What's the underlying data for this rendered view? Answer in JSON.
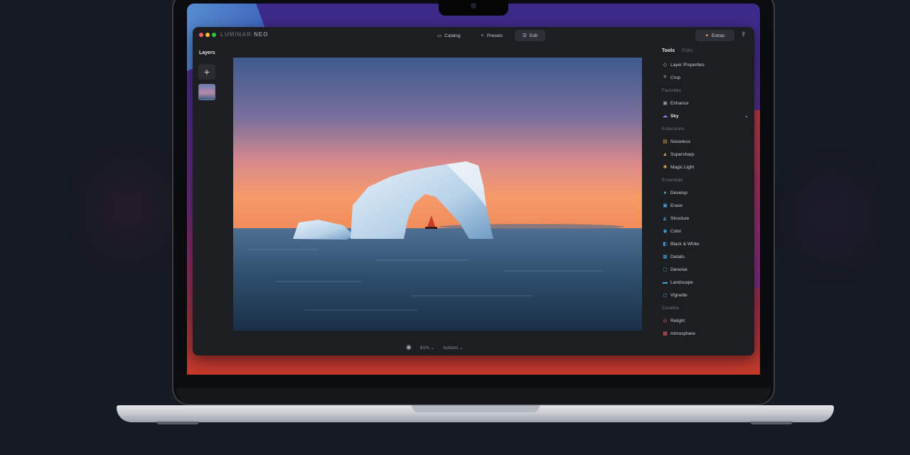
{
  "window": {
    "logo_main": "LUMINAR",
    "logo_accent": "NEO"
  },
  "tabs": [
    {
      "label": "Catalog",
      "icon": "folder-icon",
      "active": false
    },
    {
      "label": "Presets",
      "icon": "sparkle-icon",
      "active": false
    },
    {
      "label": "Edit",
      "icon": "sliders-icon",
      "active": true
    }
  ],
  "header": {
    "extras_label": "Extras",
    "share_icon": "share-icon"
  },
  "layers": {
    "title": "Layers",
    "add_label": "+"
  },
  "canvas": {
    "zoom": "61%",
    "zoom_chevron": "⌄",
    "actions_label": "Actions",
    "actions_chevron": "⌄"
  },
  "sidebar": {
    "tab_tools": "Tools",
    "tab_edits": "Edits",
    "items": [
      {
        "kind": "item",
        "label": "Layer Properties",
        "icon": "layers-icon",
        "glyph": "◇",
        "color": "#c9ccd2"
      },
      {
        "kind": "item",
        "label": "Crop",
        "icon": "crop-icon",
        "glyph": "⌗",
        "color": "#c9ccd2"
      },
      {
        "kind": "section",
        "label": "Favorites"
      },
      {
        "kind": "item",
        "label": "Enhance",
        "icon": "enhance-icon",
        "glyph": "▣",
        "color": "#9aa0aa"
      },
      {
        "kind": "item",
        "label": "Sky",
        "icon": "sky-icon",
        "glyph": "☁",
        "color": "#8f7ee0",
        "bold": true,
        "expanded": true
      },
      {
        "kind": "section",
        "label": "Extensions"
      },
      {
        "kind": "item",
        "label": "Noiseless",
        "icon": "noiseless-icon",
        "glyph": "▤",
        "color": "#e0a25a"
      },
      {
        "kind": "item",
        "label": "Supersharp",
        "icon": "supersharp-icon",
        "glyph": "▲",
        "color": "#e0a25a"
      },
      {
        "kind": "item",
        "label": "Magic Light",
        "icon": "magic-light-icon",
        "glyph": "✺",
        "color": "#e0a25a"
      },
      {
        "kind": "section",
        "label": "Essentials"
      },
      {
        "kind": "item",
        "label": "Develop",
        "icon": "develop-icon",
        "glyph": "●",
        "color": "#4aa3d8"
      },
      {
        "kind": "item",
        "label": "Erase",
        "icon": "erase-icon",
        "glyph": "▣",
        "color": "#4aa3d8"
      },
      {
        "kind": "item",
        "label": "Structure",
        "icon": "structure-icon",
        "glyph": "◭",
        "color": "#4aa3d8"
      },
      {
        "kind": "item",
        "label": "Color",
        "icon": "color-icon",
        "glyph": "◉",
        "color": "#4aa3d8"
      },
      {
        "kind": "item",
        "label": "Black & White",
        "icon": "black-white-icon",
        "glyph": "◧",
        "color": "#4aa3d8"
      },
      {
        "kind": "item",
        "label": "Details",
        "icon": "details-icon",
        "glyph": "▦",
        "color": "#4aa3d8"
      },
      {
        "kind": "item",
        "label": "Denoise",
        "icon": "denoise-icon",
        "glyph": "▢",
        "color": "#4aa3d8"
      },
      {
        "kind": "item",
        "label": "Landscape",
        "icon": "landscape-icon",
        "glyph": "▬",
        "color": "#4aa3d8"
      },
      {
        "kind": "item",
        "label": "Vignette",
        "icon": "vignette-icon",
        "glyph": "◻",
        "color": "#4aa3d8"
      },
      {
        "kind": "section",
        "label": "Creative"
      },
      {
        "kind": "item",
        "label": "Relight",
        "icon": "relight-icon",
        "glyph": "◎",
        "color": "#e05a6a"
      },
      {
        "kind": "item",
        "label": "Atmosphere",
        "icon": "atmosphere-icon",
        "glyph": "▩",
        "color": "#e05a6a"
      }
    ]
  }
}
